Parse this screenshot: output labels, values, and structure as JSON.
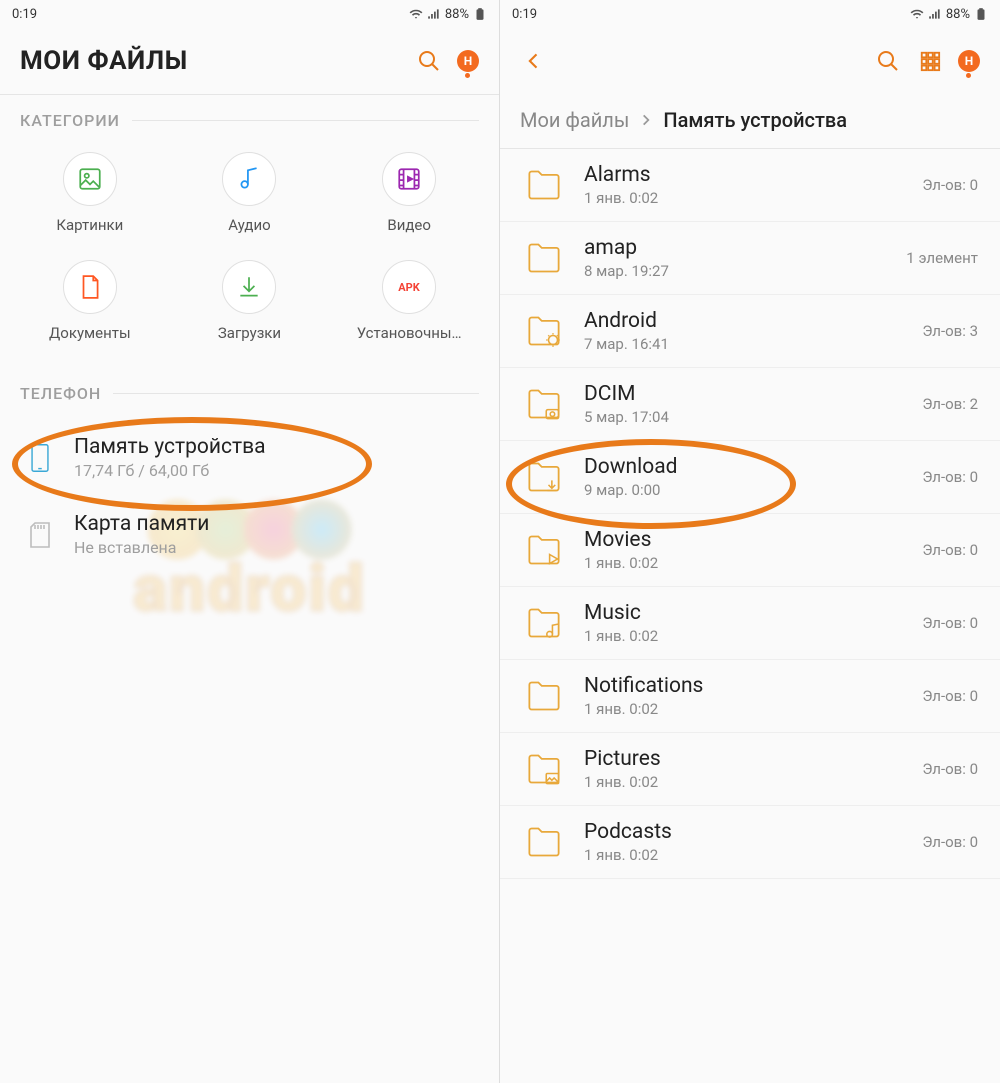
{
  "status": {
    "time": "0:19",
    "battery": "88%"
  },
  "left": {
    "title": "МОИ ФАЙЛЫ",
    "badge": "H",
    "section_categories": "КАТЕГОРИИ",
    "categories": [
      {
        "label": "Картинки",
        "icon": "image",
        "color": "#4caf50"
      },
      {
        "label": "Аудио",
        "icon": "audio",
        "color": "#2196f3"
      },
      {
        "label": "Видео",
        "icon": "video",
        "color": "#9c27b0"
      },
      {
        "label": "Документы",
        "icon": "document",
        "color": "#ff5722"
      },
      {
        "label": "Загрузки",
        "icon": "download",
        "color": "#4caf50"
      },
      {
        "label": "Установочны…",
        "icon": "apk",
        "color": "#f44336"
      }
    ],
    "section_phone": "ТЕЛЕФОН",
    "storage": [
      {
        "title": "Память устройства",
        "sub": "17,74 Гб / 64,00 Гб",
        "icon": "phone",
        "color": "#3aa8d6",
        "highlight": true
      },
      {
        "title": "Карта памяти",
        "sub": "Не вставлена",
        "icon": "sd",
        "color": "#bdbdbd",
        "highlight": false
      }
    ]
  },
  "right": {
    "badge": "H",
    "breadcrumb": {
      "root": "Мои файлы",
      "leaf": "Память устройства"
    },
    "folders": [
      {
        "name": "Alarms",
        "date": "1 янв. 0:02",
        "count": "Эл-ов: 0",
        "variant": "plain",
        "highlight": false
      },
      {
        "name": "amap",
        "date": "8 мар. 19:27",
        "count": "1 элемент",
        "variant": "plain",
        "highlight": false
      },
      {
        "name": "Android",
        "date": "7 мар. 16:41",
        "count": "Эл-ов: 3",
        "variant": "gear",
        "highlight": false
      },
      {
        "name": "DCIM",
        "date": "5 мар. 17:04",
        "count": "Эл-ов: 2",
        "variant": "camera",
        "highlight": false
      },
      {
        "name": "Download",
        "date": "9 мар. 0:00",
        "count": "Эл-ов: 0",
        "variant": "download",
        "highlight": true
      },
      {
        "name": "Movies",
        "date": "1 янв. 0:02",
        "count": "Эл-ов: 0",
        "variant": "play",
        "highlight": false
      },
      {
        "name": "Music",
        "date": "1 янв. 0:02",
        "count": "Эл-ов: 0",
        "variant": "music",
        "highlight": false
      },
      {
        "name": "Notifications",
        "date": "1 янв. 0:02",
        "count": "Эл-ов: 0",
        "variant": "plain",
        "highlight": false
      },
      {
        "name": "Pictures",
        "date": "1 янв. 0:02",
        "count": "Эл-ов: 0",
        "variant": "image",
        "highlight": false
      },
      {
        "name": "Podcasts",
        "date": "1 янв. 0:02",
        "count": "Эл-ов: 0",
        "variant": "plain",
        "highlight": false
      }
    ]
  }
}
